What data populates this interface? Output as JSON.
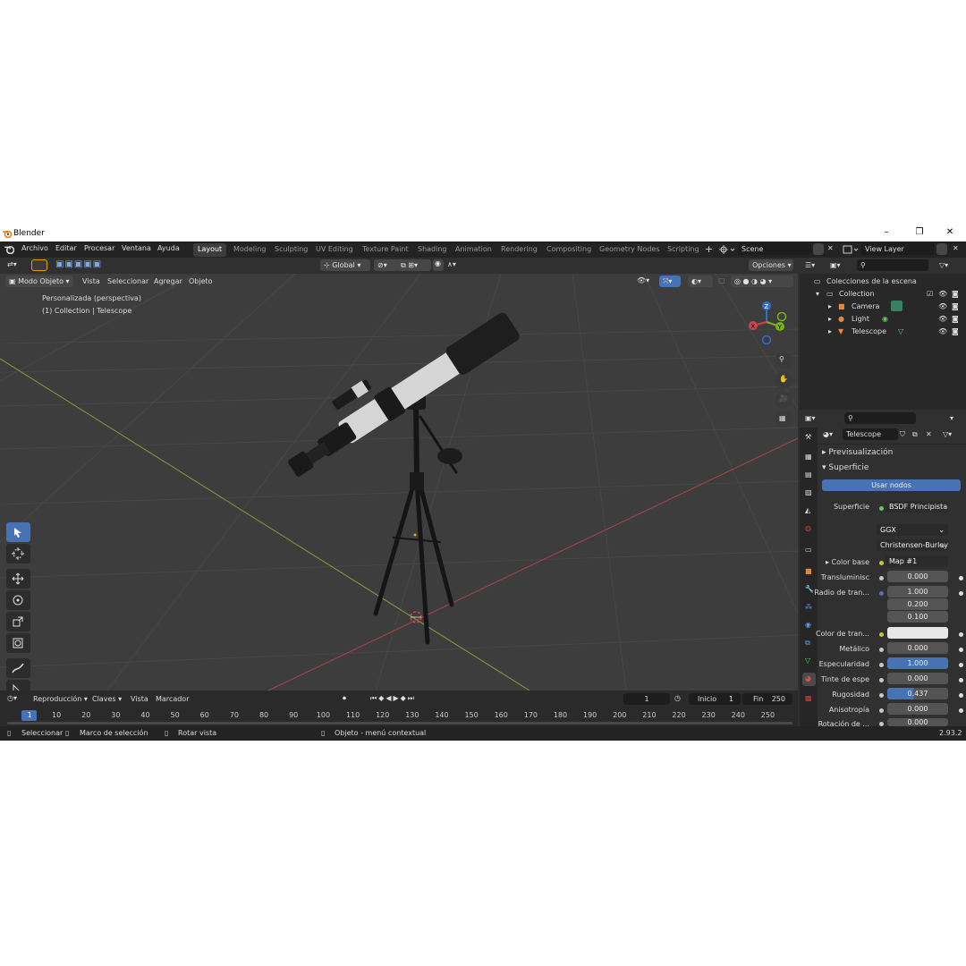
{
  "window": {
    "title": "Blender",
    "version": "2.93.2"
  },
  "menu": [
    "Archivo",
    "Editar",
    "Procesar",
    "Ventana",
    "Ayuda"
  ],
  "workspaces": [
    "Layout",
    "Modeling",
    "Sculpting",
    "UV Editing",
    "Texture Paint",
    "Shading",
    "Animation",
    "Rendering",
    "Compositing",
    "Geometry Nodes",
    "Scripting"
  ],
  "active_workspace": "Layout",
  "scene": {
    "name": "Scene",
    "view_layer": "View Layer"
  },
  "viewport": {
    "transform_orientation": "Global",
    "options_label": "Opciones",
    "mode": "Modo Objeto",
    "header_menu": [
      "Vista",
      "Seleccionar",
      "Agregar",
      "Objeto"
    ],
    "view_name": "Personalizada (perspectiva)",
    "collection_info": "(1) Collection | Telescope",
    "gizmo": {
      "z": "Z",
      "y": "Y",
      "x": "X"
    }
  },
  "timeline": {
    "menu": [
      "Reproducción",
      "Claves",
      "Vista",
      "Marcador"
    ],
    "current_frame": "1",
    "start_label": "Inicio",
    "start": "1",
    "end_label": "Fin",
    "end": "250",
    "ticks": [
      "1",
      "10",
      "20",
      "30",
      "40",
      "50",
      "60",
      "70",
      "80",
      "90",
      "100",
      "110",
      "120",
      "130",
      "140",
      "150",
      "160",
      "170",
      "180",
      "190",
      "200",
      "210",
      "220",
      "230",
      "240",
      "250"
    ]
  },
  "status": {
    "select": "Seleccionar",
    "box_select": "Marco de selección",
    "rotate": "Rotar vista",
    "context": "Objeto - menú contextual"
  },
  "outliner": {
    "root": "Colecciones de la escena",
    "collection": "Collection",
    "items": [
      "Camera",
      "Light",
      "Telescope"
    ]
  },
  "properties": {
    "object_name": "Telescope",
    "sections": {
      "preview": "Previsualización",
      "surface": "Superficie"
    },
    "use_nodes": "Usar nodos",
    "surface_label": "Superficie",
    "surface_value": "BSDF Principista",
    "distribution": "GGX",
    "subsurface_method": "Christensen-Burley",
    "rows": [
      {
        "label": "Color base",
        "value": "Map #1"
      },
      {
        "label": "Transluminisc",
        "value": "0.000"
      },
      {
        "label": "Radio de tran...",
        "values": [
          "1.000",
          "0.200",
          "0.100"
        ]
      },
      {
        "label": "Color de tran...",
        "value": ""
      },
      {
        "label": "Metálico",
        "value": "0.000"
      },
      {
        "label": "Especularidad",
        "value": "1.000"
      },
      {
        "label": "Tinte de espe",
        "value": "0.000"
      },
      {
        "label": "Rugosidad",
        "value": "0.437"
      },
      {
        "label": "Anisotropía",
        "value": "0.000"
      },
      {
        "label": "Rotación de ...",
        "value": "0.000"
      }
    ]
  }
}
